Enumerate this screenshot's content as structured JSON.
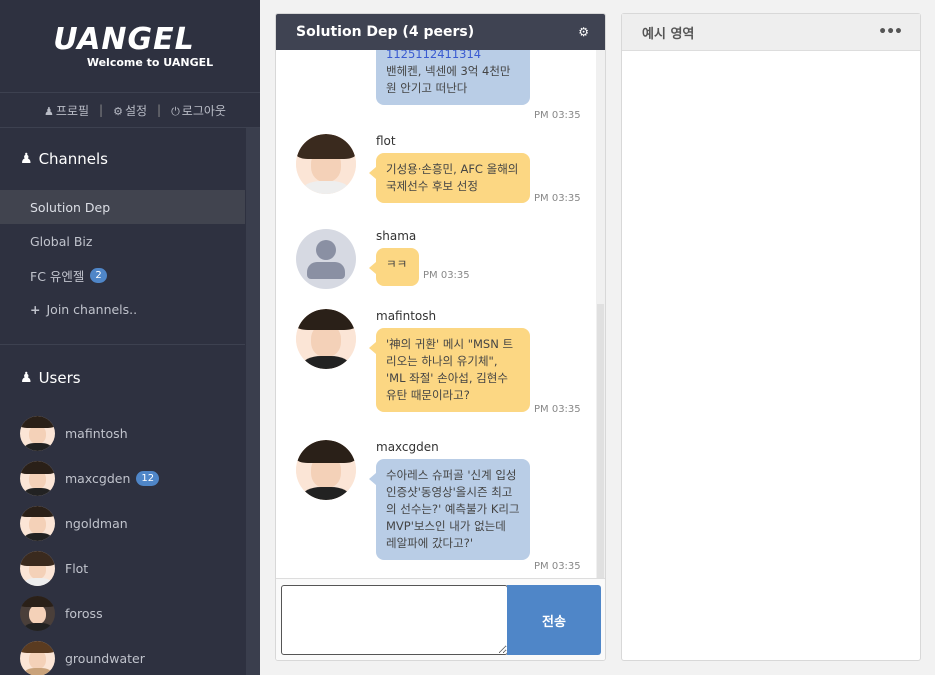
{
  "logo": {
    "brand": "UANGEL",
    "welcome": "Welcome to UANGEL"
  },
  "usermenu": {
    "profile": "프로필",
    "settings": "설정",
    "logout": "로그아웃"
  },
  "channels": {
    "title": "Channels",
    "items": [
      {
        "label": "Solution Dep",
        "badge": "",
        "active": true
      },
      {
        "label": "Global Biz",
        "badge": ""
      },
      {
        "label": "FC 유엔젤",
        "badge": "2"
      }
    ],
    "join": "Join channels.."
  },
  "users": {
    "title": "Users",
    "items": [
      {
        "label": "mafintosh",
        "badge": ""
      },
      {
        "label": "maxcgden",
        "badge": "12"
      },
      {
        "label": "ngoldman",
        "badge": ""
      },
      {
        "label": "Flot",
        "badge": ""
      },
      {
        "label": "foross",
        "badge": ""
      },
      {
        "label": "groundwater",
        "badge": ""
      }
    ]
  },
  "chat": {
    "title": "Solution Dep (4 peers)",
    "messages": [
      {
        "link": "1125112411314",
        "text": "밴헤켄, 넥센에 3억 4천만 원 안기고 떠난다",
        "time": "PM 03:35"
      },
      {
        "sender": "flot",
        "text": "기성용·손흥민, AFC 올해의 국제선수 후보 선정",
        "time": "PM 03:35"
      },
      {
        "sender": "shama",
        "text": "ㅋㅋ",
        "time": "PM 03:35"
      },
      {
        "sender": "mafintosh",
        "text": "'神의 귀환' 메시 \"MSN 트리오는 하나의 유기체\", 'ML 좌절' 손아섭, 김현수 유탄 때문이라고?",
        "time": "PM 03:35"
      },
      {
        "sender": "maxcgden",
        "text": "수아레스 슈퍼골 '신계 입성 인증샷'동영상'올시즌 최고의 선수는?' 예측불가 K리그 MVP'보스인 내가 없는데 레알파에 갔다고?'",
        "time": "PM 03:35"
      }
    ],
    "send_label": "전송",
    "input_value": ""
  },
  "example": {
    "title": "예시 영역"
  }
}
